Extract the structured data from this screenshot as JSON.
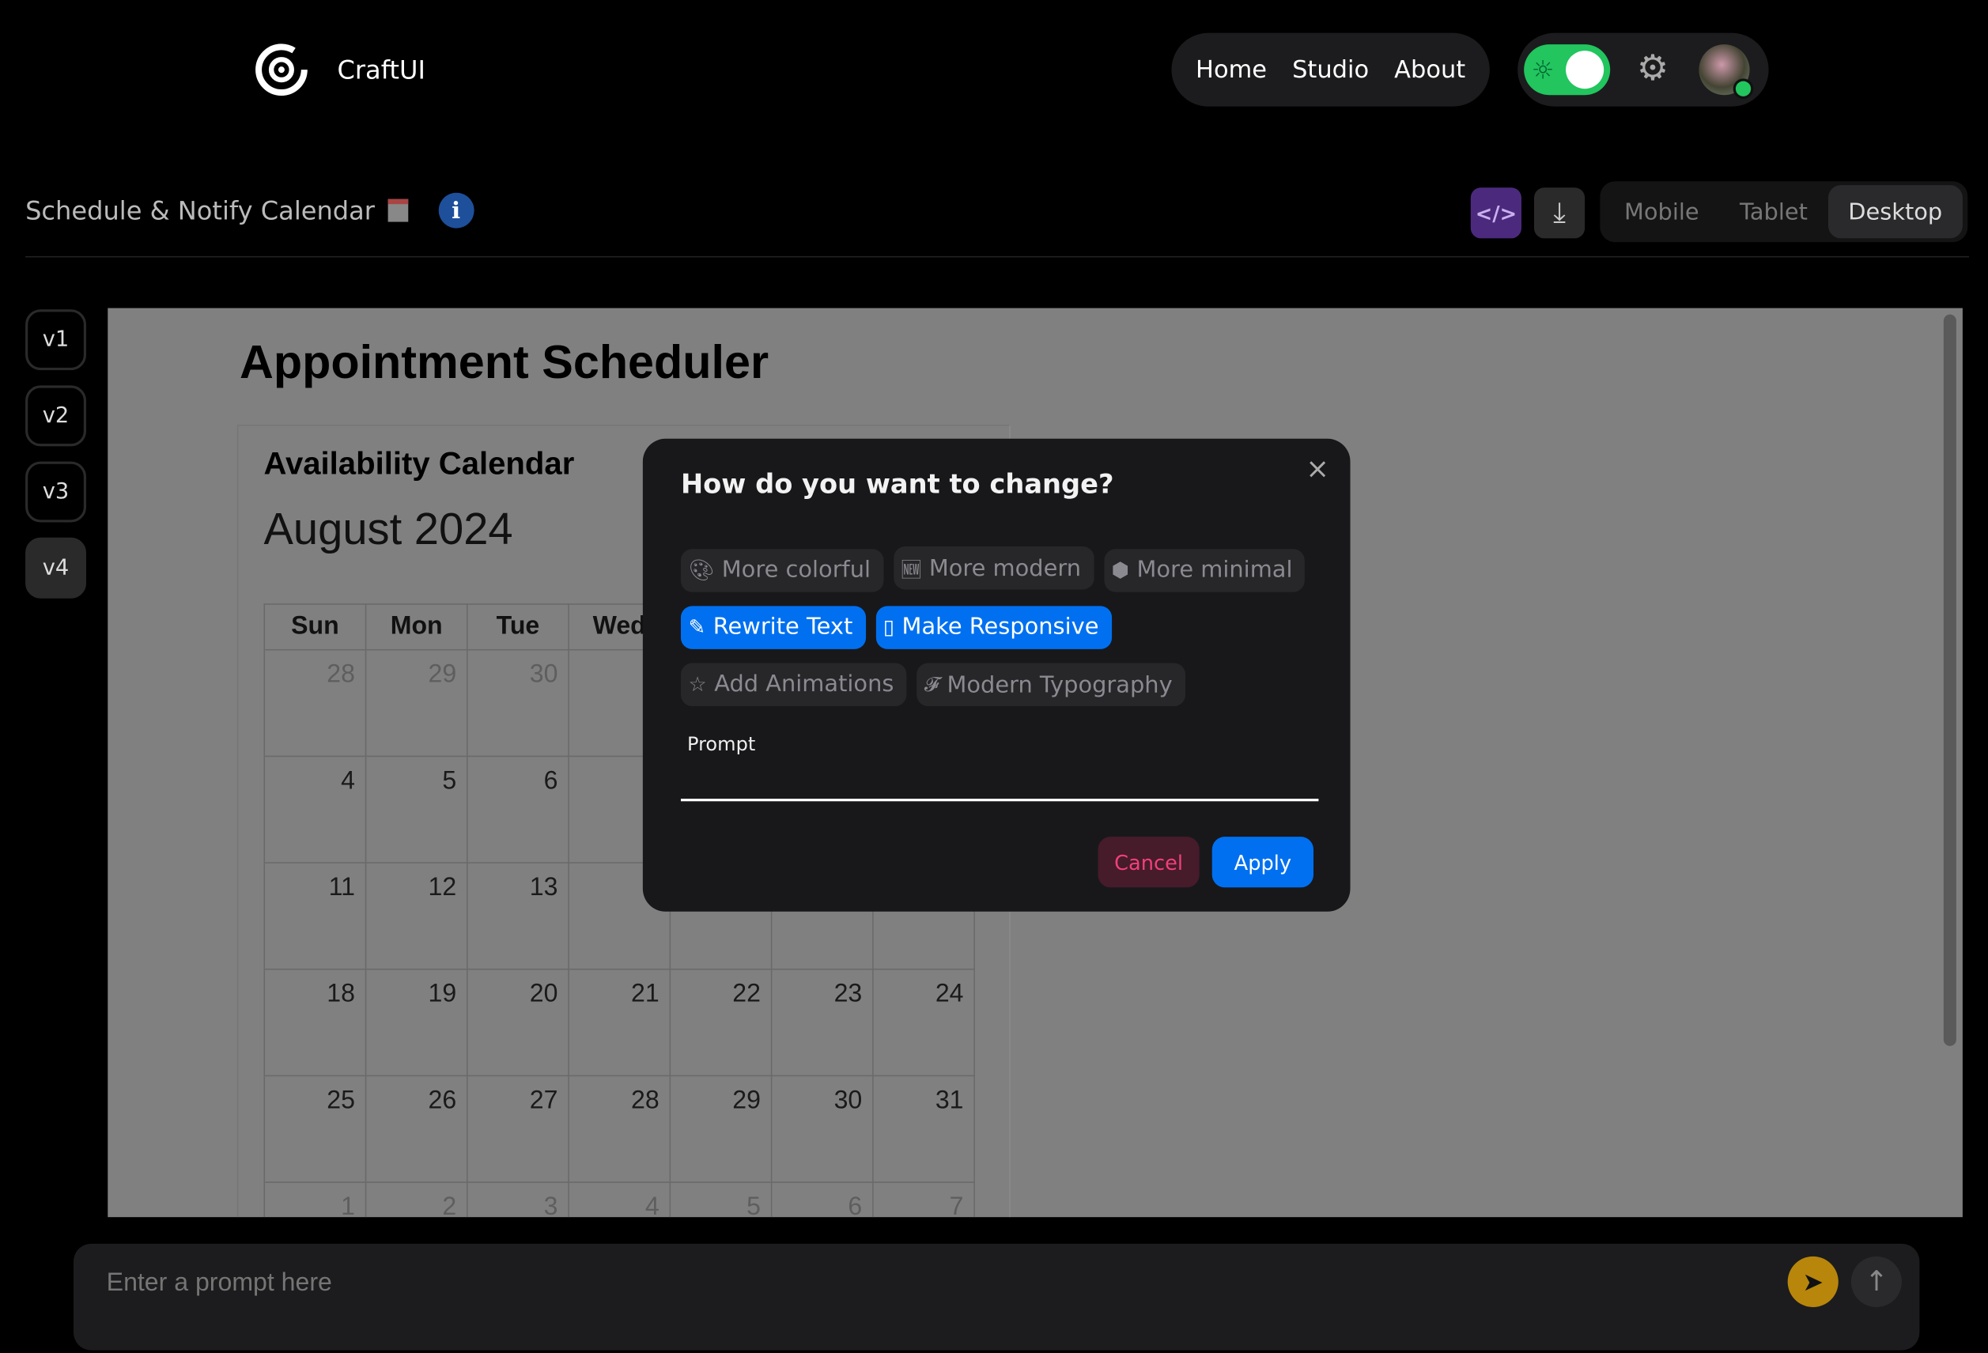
{
  "brand": {
    "name": "CraftUI"
  },
  "nav": {
    "items": [
      "Home",
      "Studio",
      "About"
    ]
  },
  "theme_toggle": {
    "on": true,
    "color": "#22c55e"
  },
  "project": {
    "title": "Schedule & Notify Calendar"
  },
  "view_modes": {
    "options": [
      "Mobile",
      "Tablet",
      "Desktop"
    ],
    "selected": "Desktop"
  },
  "versions": [
    "v1",
    "v2",
    "v3",
    "v4"
  ],
  "selected_version": "v4",
  "preview": {
    "title": "Appointment Scheduler",
    "card_title": "Availability Calendar",
    "month": "August 2024",
    "weekdays": [
      "Sun",
      "Mon",
      "Tue",
      "Wed",
      "",
      "",
      ""
    ],
    "weeks": [
      [
        [
          "28",
          1
        ],
        [
          "29",
          1
        ],
        [
          "30",
          1
        ],
        [
          "",
          0
        ],
        [
          "",
          0
        ],
        [
          "",
          0
        ],
        [
          "",
          0
        ]
      ],
      [
        [
          "4",
          0
        ],
        [
          "5",
          0
        ],
        [
          "6",
          0
        ],
        [
          "",
          0
        ],
        [
          "",
          0
        ],
        [
          "",
          0
        ],
        [
          "",
          0
        ]
      ],
      [
        [
          "11",
          0
        ],
        [
          "12",
          0
        ],
        [
          "13",
          0
        ],
        [
          "",
          0
        ],
        [
          "",
          0
        ],
        [
          "",
          0
        ],
        [
          "",
          0
        ]
      ],
      [
        [
          "18",
          0
        ],
        [
          "19",
          0
        ],
        [
          "20",
          0
        ],
        [
          "21",
          0
        ],
        [
          "22",
          0
        ],
        [
          "23",
          0
        ],
        [
          "24",
          0
        ]
      ],
      [
        [
          "25",
          0
        ],
        [
          "26",
          0
        ],
        [
          "27",
          0
        ],
        [
          "28",
          0
        ],
        [
          "29",
          0
        ],
        [
          "30",
          0
        ],
        [
          "31",
          0
        ]
      ],
      [
        [
          "1",
          1
        ],
        [
          "2",
          1
        ],
        [
          "3",
          1
        ],
        [
          "4",
          1
        ],
        [
          "5",
          1
        ],
        [
          "6",
          1
        ],
        [
          "7",
          1
        ]
      ]
    ]
  },
  "modal": {
    "title": "How do you want to change?",
    "options": [
      {
        "label": "More colorful",
        "icon": "palette-icon",
        "selected": false
      },
      {
        "label": "More modern",
        "icon": "new-badge-icon",
        "selected": false
      },
      {
        "label": "More minimal",
        "icon": "cube-icon",
        "selected": false
      },
      {
        "label": "Rewrite Text",
        "icon": "pencil-icon",
        "selected": true
      },
      {
        "label": "Make Responsive",
        "icon": "phone-icon",
        "selected": true
      },
      {
        "label": "Add Animations",
        "icon": "sparkle-star-icon",
        "selected": false
      },
      {
        "label": "Modern Typography",
        "icon": "font-icon",
        "selected": false
      }
    ],
    "prompt_label": "Prompt",
    "prompt_value": "",
    "cancel": "Cancel",
    "apply": "Apply"
  },
  "prompt_bar": {
    "placeholder": "Enter a prompt here"
  },
  "colors": {
    "accent": "#0070f0",
    "cancel_text": "#f0407a",
    "code_button": "#4b2a7d",
    "send_select": "#b8860b"
  }
}
